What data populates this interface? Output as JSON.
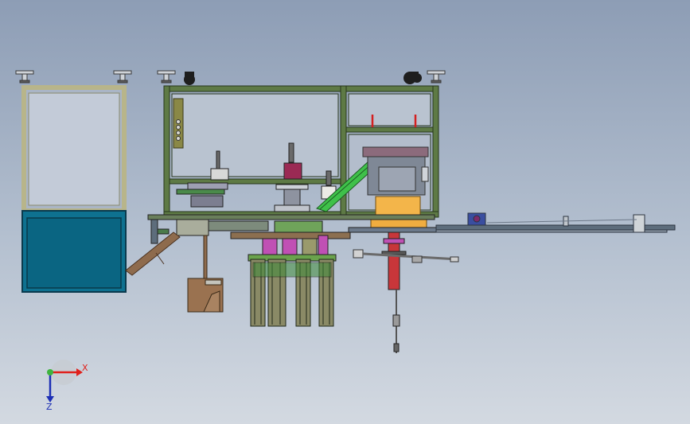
{
  "axes": {
    "x_label": "X",
    "z_label": "Z",
    "x_color": "#e0201b",
    "z_color": "#1d2fb5",
    "y_color": "#3fb43f"
  },
  "colors": {
    "frame_green": "#5e7a45",
    "frame_dark": "#27361c",
    "enclosure_border": "#b8b58a",
    "cabinet_blue": "#0e7190",
    "cabinet_glass": "#c7cfdc",
    "chute_brown": "#8e6b4d",
    "bin_brown": "#9a7250",
    "conveyor_green": "#3fc14a",
    "hopper_orange": "#f3b54a",
    "actuator_red": "#c8363a",
    "magenta": "#c050b4",
    "rail_grey": "#5d6d7c",
    "lamp_red": "#d32020"
  }
}
